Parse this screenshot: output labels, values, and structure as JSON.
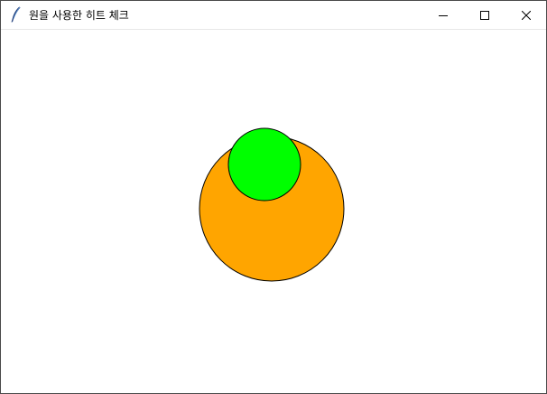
{
  "window": {
    "title": "원을 사용한 히트 체크"
  },
  "caption_buttons": {
    "minimize_icon": "minimize-icon",
    "maximize_icon": "maximize-icon",
    "close_icon": "close-icon"
  },
  "canvas": {
    "background": "#ffffff",
    "circles": [
      {
        "name": "orange-circle",
        "fill": "#ffa500",
        "stroke": "#000000"
      },
      {
        "name": "green-circle",
        "fill": "#00ff00",
        "stroke": "#000000"
      }
    ]
  }
}
